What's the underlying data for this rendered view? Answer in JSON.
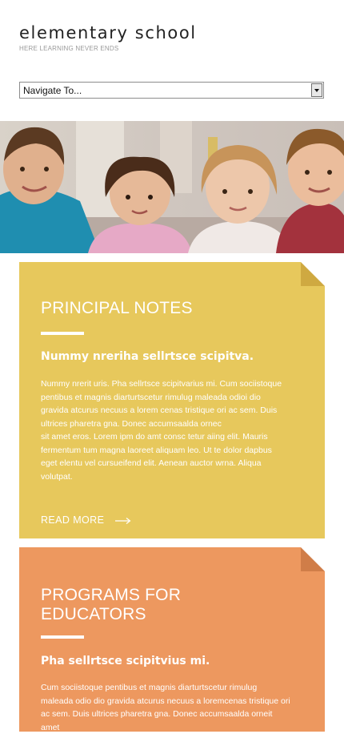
{
  "site": {
    "title": "elementary school",
    "tagline": "HERE LEARNING NEVER ENDS"
  },
  "navigation": {
    "selected": "Navigate To..."
  },
  "hero": {
    "image": "photo of four smiling children"
  },
  "cards": [
    {
      "heading": "PRINCIPAL NOTES",
      "subheading": "Nummy nreriha sellrtsce scipitva.",
      "body": [
        "Nummy nrerit uris. Pha sellrtsce scipitvarius mi. Cum sociistoque",
        "pentibus et magnis diarturtscetur rimulug maleada odioi dio",
        "gravida atcurus necuus a lorem cenas tristique ori ac sem. Duis",
        "ultrices pharetra gna. Donec accumsaalda ornec",
        "sit amet eros. Lorem ipm do amt consc tetur aiing elit. Mauris",
        "fermentum tum magna laoreet aliquam leo. Ut te dolor dapbus",
        "eget elentu vel cursueifend elit. Aenean auctor wrna. Aliqua",
        "volutpat."
      ],
      "link": "READ MORE",
      "color": "#e7c85c"
    },
    {
      "heading_lines": [
        "PROGRAMS FOR",
        "EDUCATORS"
      ],
      "subheading": "Pha sellrtsce scipitvius mi.",
      "body": [
        "Cum sociistoque pentibus et magnis diarturtscetur rimulug",
        "maleada odio dio gravida atcurus necuus a loremcenas tristique ori",
        "ac sem. Duis ultrices pharetra gna. Donec accumsaalda orneit amet"
      ],
      "color": "#ed985f"
    }
  ]
}
